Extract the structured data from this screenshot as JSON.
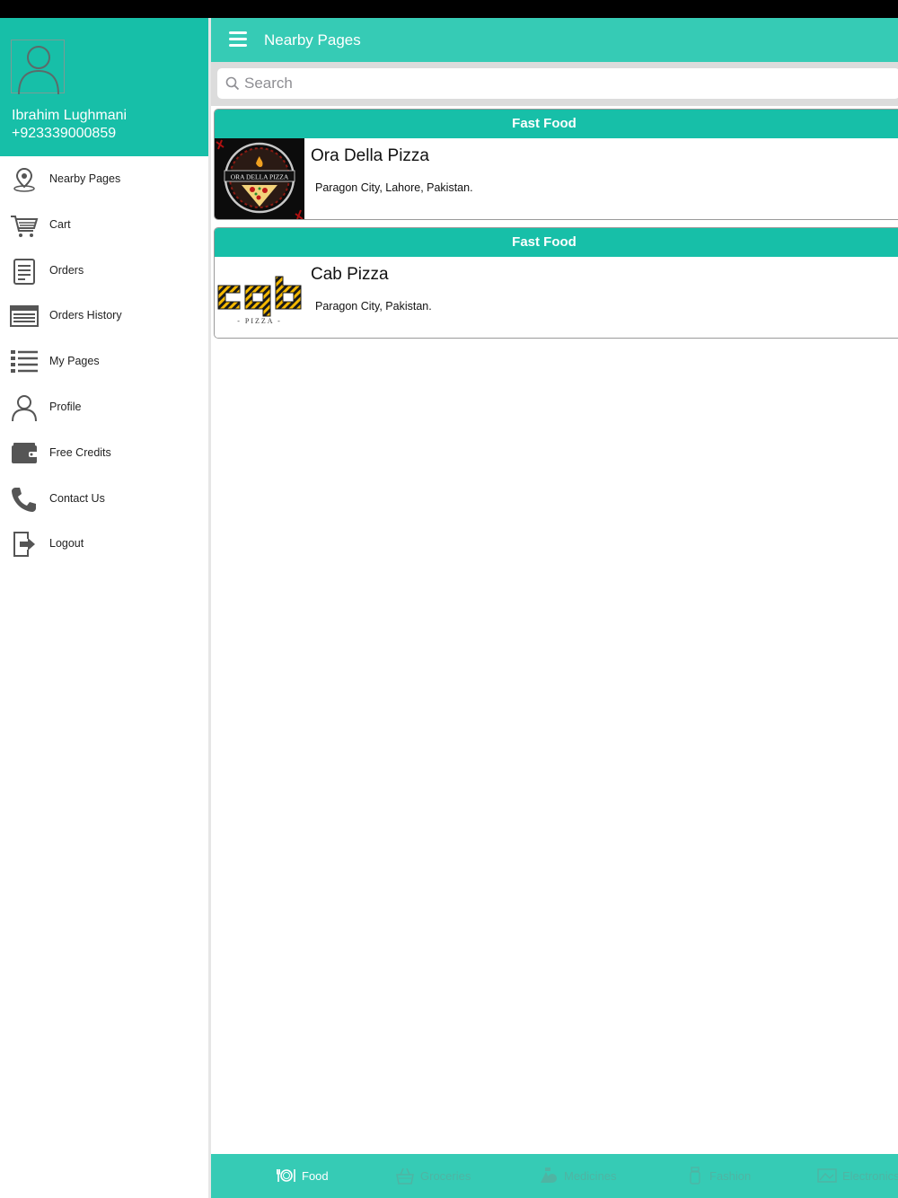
{
  "drawer": {
    "user_name": "Ibrahim Lughmani",
    "user_phone": "+923339000859",
    "items": [
      {
        "label": "Nearby Pages",
        "icon": "map-pin-icon"
      },
      {
        "label": "Cart",
        "icon": "cart-icon"
      },
      {
        "label": "Orders",
        "icon": "document-icon"
      },
      {
        "label": "Orders History",
        "icon": "list-table-icon"
      },
      {
        "label": "My Pages",
        "icon": "list-icon"
      },
      {
        "label": "Profile",
        "icon": "user-icon"
      },
      {
        "label": "Free Credits",
        "icon": "wallet-icon"
      },
      {
        "label": "Contact Us",
        "icon": "phone-icon"
      },
      {
        "label": "Logout",
        "icon": "logout-icon"
      }
    ]
  },
  "header": {
    "title": "Nearby Pages"
  },
  "search": {
    "placeholder": "Search",
    "value": ""
  },
  "cards": [
    {
      "category": "Fast Food",
      "name": "Ora Della Pizza",
      "address": "Paragon City, Lahore, Pakistan.",
      "logo_text": "ORA DELLA PIZZA"
    },
    {
      "category": "Fast Food",
      "name": "Cab Pizza",
      "address": "Paragon City, Pakistan.",
      "logo_text": "cab",
      "logo_sub": "- PIZZA -"
    }
  ],
  "tabs": [
    {
      "label": "Food",
      "icon": "food-plate-icon",
      "active": true
    },
    {
      "label": "Groceries",
      "icon": "grocery-basket-icon",
      "active": false
    },
    {
      "label": "Medicines",
      "icon": "medicine-icon",
      "active": false
    },
    {
      "label": "Fashion",
      "icon": "fashion-icon",
      "active": false
    },
    {
      "label": "Electronics",
      "icon": "electronics-icon",
      "active": false
    }
  ],
  "colors": {
    "primary": "#36cbb5",
    "category_band": "#17bfa8",
    "inactive_tab_text": "#4fb4a3"
  }
}
